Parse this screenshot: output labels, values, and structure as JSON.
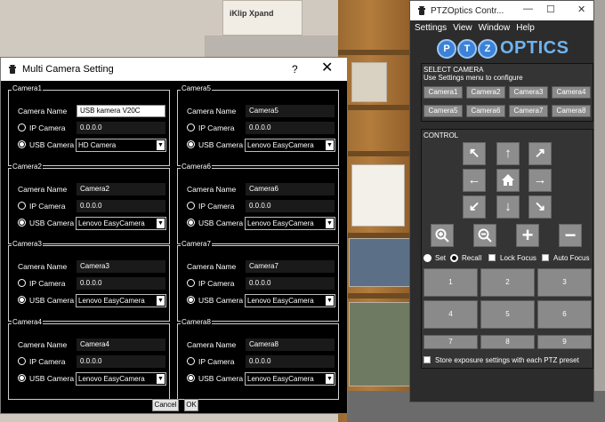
{
  "dialog": {
    "title": "Multi Camera Setting",
    "help": "?",
    "close": "✕",
    "labels": {
      "name": "Camera Name",
      "ip": "IP Camera",
      "usb": "USB Camera"
    },
    "cameras": [
      {
        "group": "Camera1",
        "name": "USB kamera V20C",
        "ip": "0.0.0.0",
        "device": "HD Camera",
        "mode": "USB"
      },
      {
        "group": "Camera2",
        "name": "Camera2",
        "ip": "0.0.0.0",
        "device": "Lenovo EasyCamera",
        "mode": "USB"
      },
      {
        "group": "Camera3",
        "name": "Camera3",
        "ip": "0.0.0.0",
        "device": "Lenovo EasyCamera",
        "mode": "USB"
      },
      {
        "group": "Camera4",
        "name": "Camera4",
        "ip": "0.0.0.0",
        "device": "Lenovo EasyCamera",
        "mode": "USB"
      },
      {
        "group": "Camera5",
        "name": "Camera5",
        "ip": "0.0.0.0",
        "device": "Lenovo EasyCamera",
        "mode": "USB"
      },
      {
        "group": "Camera6",
        "name": "Camera6",
        "ip": "0.0.0.0",
        "device": "Lenovo EasyCamera",
        "mode": "USB"
      },
      {
        "group": "Camera7",
        "name": "Camera7",
        "ip": "0.0.0.0",
        "device": "Lenovo EasyCamera",
        "mode": "USB"
      },
      {
        "group": "Camera8",
        "name": "Camera8",
        "ip": "0.0.0.0",
        "device": "Lenovo EasyCamera",
        "mode": "USB"
      }
    ],
    "cancel": "Cancel",
    "ok": "OK"
  },
  "ptz": {
    "title": "PTZOptics Contr...",
    "controls": {
      "minimize": "—",
      "maximize": "☐",
      "close": "✕"
    },
    "menu": [
      "Settings",
      "View",
      "Window",
      "Help"
    ],
    "logo": "OPTICS",
    "select_camera": {
      "heading": "SELECT CAMERA",
      "hint": "Use Settings menu to configure",
      "buttons": [
        "Camera1",
        "Camera2",
        "Camera3",
        "Camera4",
        "Camera5",
        "Camera6",
        "Camera7",
        "Camera8"
      ]
    },
    "control": {
      "heading": "CONTROL",
      "set": "Set",
      "recall": "Recall",
      "lock_focus": "Lock Focus",
      "auto_focus": "Auto Focus",
      "presets": [
        "1",
        "2",
        "3",
        "4",
        "5",
        "6",
        "7",
        "8",
        "9"
      ],
      "store_exposure": "Store exposure settings with each PTZ preset"
    }
  },
  "background": {
    "box_text": "iKlip Xpand"
  }
}
